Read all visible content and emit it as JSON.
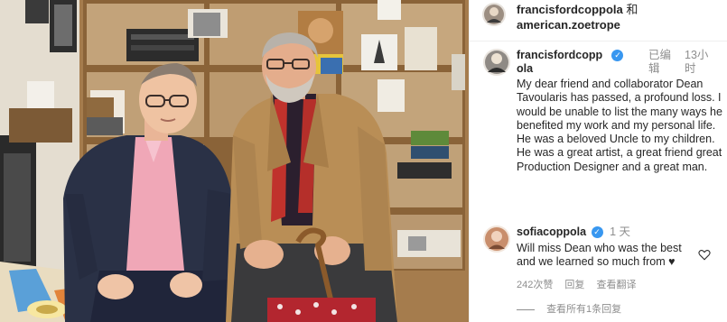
{
  "header": {
    "account_1": "francisfordcoppola",
    "and": "和",
    "account_2": "american.zoetrope"
  },
  "post": {
    "author": "francisfordcoppola",
    "verified_icon": "verified-badge-icon",
    "edited": "已编辑",
    "time": "13小时",
    "caption": "My dear friend and collaborator Dean Tavoularis has passed, a profound loss. I would be unable to list the many ways he benefited my work and my personal life. He was a beloved Uncle to my children. He was a great artist, a great friend great Production Designer and a great man."
  },
  "comment": {
    "author": "sofiacoppola",
    "time": "1 天",
    "text": "Will miss Dean who was the best and we learned so much from",
    "heart_emoji": "♥",
    "likes": "242次赞",
    "reply": "回复",
    "translate": "查看翻译",
    "view_replies": "查看所有1条回复"
  },
  "colors": {
    "verified": "#3897f0",
    "muted_text": "#8e8e8e",
    "primary_text": "#262626",
    "divider": "#efefef"
  }
}
